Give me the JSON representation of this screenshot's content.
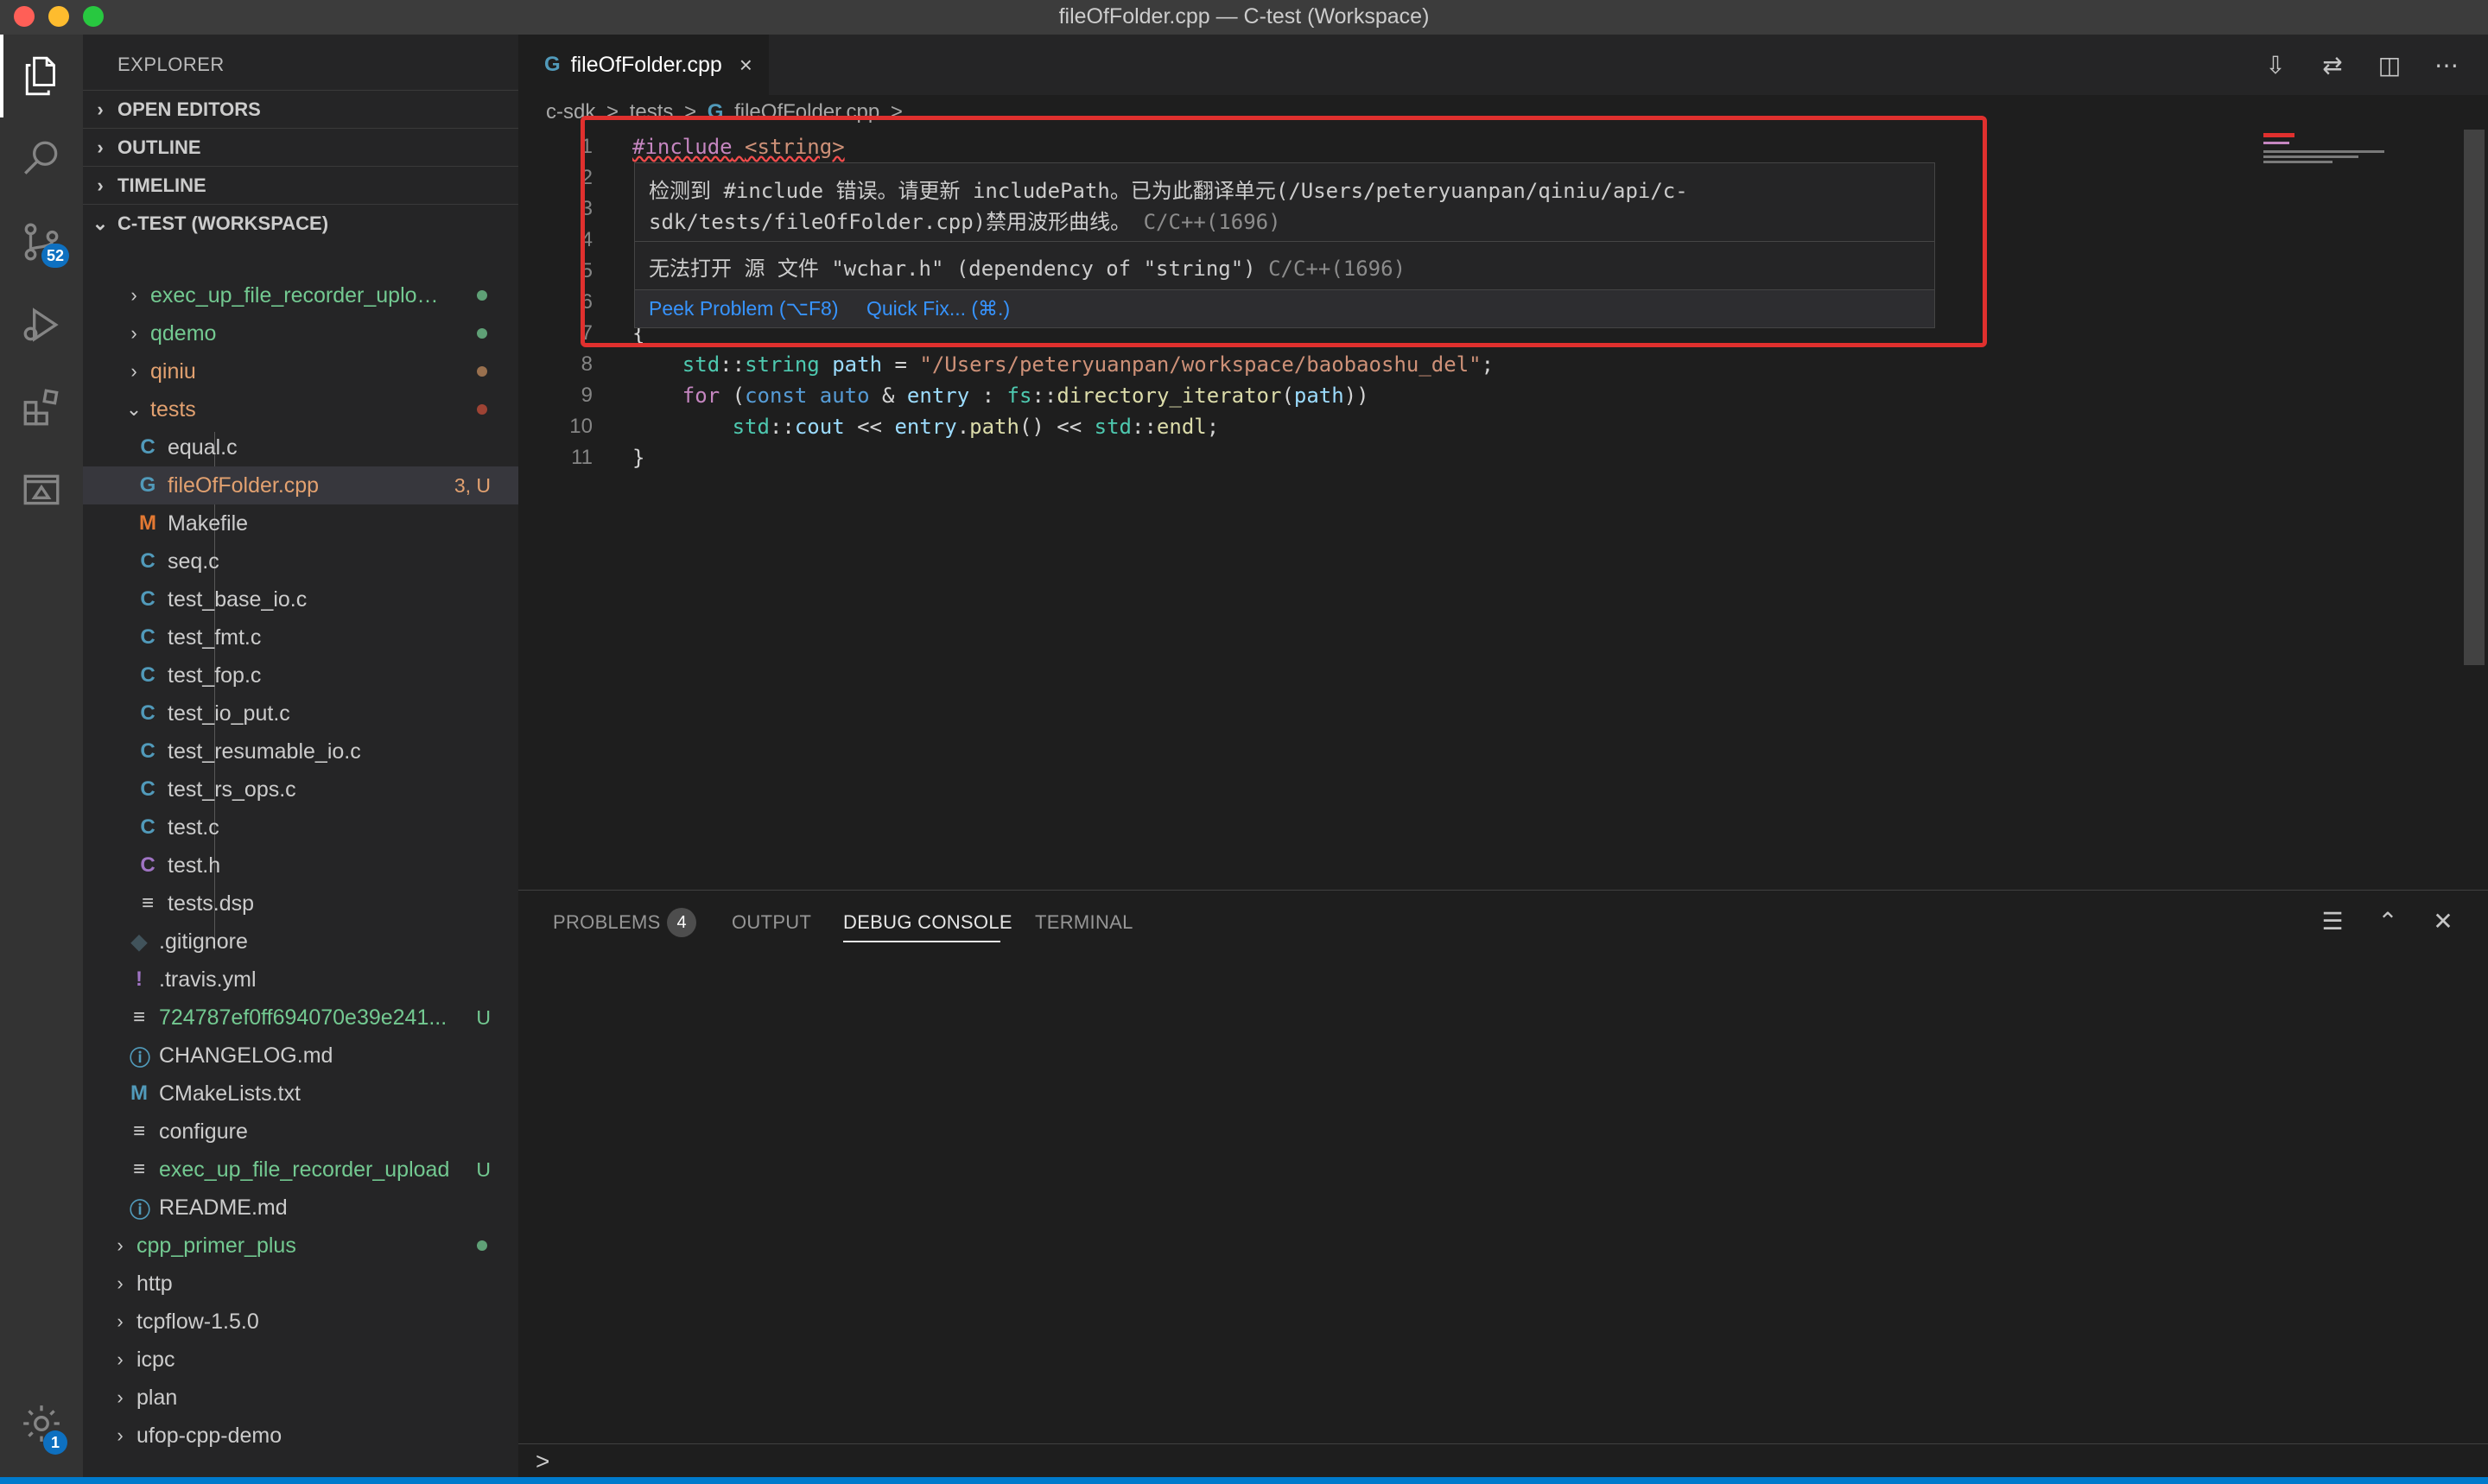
{
  "window": {
    "title": "fileOfFolder.cpp — C-test (Workspace)",
    "traffic_lights": [
      "#ff5f57",
      "#febc2e",
      "#28c840"
    ]
  },
  "activity_bar": {
    "items": [
      {
        "name": "explorer-icon"
      },
      {
        "name": "search-icon"
      },
      {
        "name": "source-control-icon",
        "badge": "52"
      },
      {
        "name": "run-debug-icon"
      },
      {
        "name": "extensions-icon"
      },
      {
        "name": "remote-explorer-icon"
      }
    ],
    "settings_badge": "1"
  },
  "sidebar": {
    "title": "EXPLORER",
    "sections": [
      "OPEN EDITORS",
      "OUTLINE",
      "TIMELINE",
      "C-TEST (WORKSPACE)"
    ],
    "tree": [
      {
        "name": "exec_up_file_recorder_upload...",
        "type": "folder",
        "color": "green",
        "dot": "#73c991"
      },
      {
        "name": "qdemo",
        "type": "folder",
        "color": "green",
        "dot": "#73c991"
      },
      {
        "name": "qiniu",
        "type": "folder",
        "color": "orange",
        "dot": "#c08a5c"
      },
      {
        "name": "tests",
        "type": "folder-open",
        "color": "orange",
        "dot": "#c74e39"
      },
      {
        "name": "equal.c",
        "icon": "C",
        "icon_color": "#519aba"
      },
      {
        "name": "fileOfFolder.cpp",
        "icon": "G",
        "icon_color": "#519aba",
        "decoration": "3, U",
        "color": "orange",
        "selected": true
      },
      {
        "name": "Makefile",
        "icon": "M",
        "icon_color": "#e37933"
      },
      {
        "name": "seq.c",
        "icon": "C",
        "icon_color": "#519aba"
      },
      {
        "name": "test_base_io.c",
        "icon": "C",
        "icon_color": "#519aba"
      },
      {
        "name": "test_fmt.c",
        "icon": "C",
        "icon_color": "#519aba"
      },
      {
        "name": "test_fop.c",
        "icon": "C",
        "icon_color": "#519aba"
      },
      {
        "name": "test_io_put.c",
        "icon": "C",
        "icon_color": "#519aba"
      },
      {
        "name": "test_resumable_io.c",
        "icon": "C",
        "icon_color": "#519aba"
      },
      {
        "name": "test_rs_ops.c",
        "icon": "C",
        "icon_color": "#519aba"
      },
      {
        "name": "test.c",
        "icon": "C",
        "icon_color": "#519aba"
      },
      {
        "name": "test.h",
        "icon": "C",
        "icon_color": "#a074c4"
      },
      {
        "name": "tests.dsp",
        "icon": "≡",
        "icon_color": "#cccccc"
      },
      {
        "name": ".gitignore",
        "icon": "◆",
        "icon_color": "#41535b"
      },
      {
        "name": ".travis.yml",
        "icon": "!",
        "icon_color": "#a074c4"
      },
      {
        "name": "724787ef0ff694070e39e241...",
        "icon": "≡",
        "icon_color": "#cccccc",
        "color": "green",
        "decoration": "U"
      },
      {
        "name": "CHANGELOG.md",
        "icon": "ⓘ",
        "icon_color": "#519aba"
      },
      {
        "name": "CMakeLists.txt",
        "icon": "M",
        "icon_color": "#519aba"
      },
      {
        "name": "configure",
        "icon": "≡",
        "icon_color": "#cccccc"
      },
      {
        "name": "exec_up_file_recorder_upload",
        "icon": "≡",
        "icon_color": "#cccccc",
        "color": "green",
        "decoration": "U"
      },
      {
        "name": "README.md",
        "icon": "ⓘ",
        "icon_color": "#519aba"
      },
      {
        "name": "cpp_primer_plus",
        "type": "folder",
        "color": "green",
        "dot": "#73c991"
      },
      {
        "name": "http",
        "type": "folder"
      },
      {
        "name": "tcpflow-1.5.0",
        "type": "folder"
      },
      {
        "name": "icpc",
        "type": "folder"
      },
      {
        "name": "plan",
        "type": "folder"
      },
      {
        "name": "ufop-cpp-demo",
        "type": "folder"
      }
    ]
  },
  "editor": {
    "tab": {
      "icon": "G",
      "label": "fileOfFolder.cpp",
      "close": "×"
    },
    "breadcrumb": [
      "c-sdk",
      ">",
      "tests",
      ">",
      "G",
      "fileOfFolder.cpp",
      ">",
      "..."
    ],
    "line_numbers": [
      "1",
      "2",
      "3",
      "4",
      "5",
      "6",
      "7",
      "8",
      "9",
      "10",
      "11"
    ],
    "hover": {
      "message_line1": "检测到 #include 错误。请更新 includePath。已为此翻译单元(/Users/peteryuanpan/qiniu/api/c-",
      "message_line2": "sdk/tests/fileOfFolder.cpp)禁用波形曲线。",
      "message_source": "C/C++(1696)",
      "message2": "无法打开 源 文件 \"wchar.h\" (dependency of \"string\")",
      "message2_source": "C/C++(1696)",
      "peek_label": "Peek Problem (⌥F8)",
      "quickfix_label": "Quick Fix... (⌘.)"
    }
  },
  "panel": {
    "tabs": [
      "PROBLEMS",
      "OUTPUT",
      "DEBUG CONSOLE",
      "TERMINAL"
    ],
    "problems_count": "4",
    "active_tab": "DEBUG CONSOLE",
    "prompt": ">"
  },
  "colors": {
    "accent": "#007acc",
    "highlight_box": "#e0302e"
  }
}
